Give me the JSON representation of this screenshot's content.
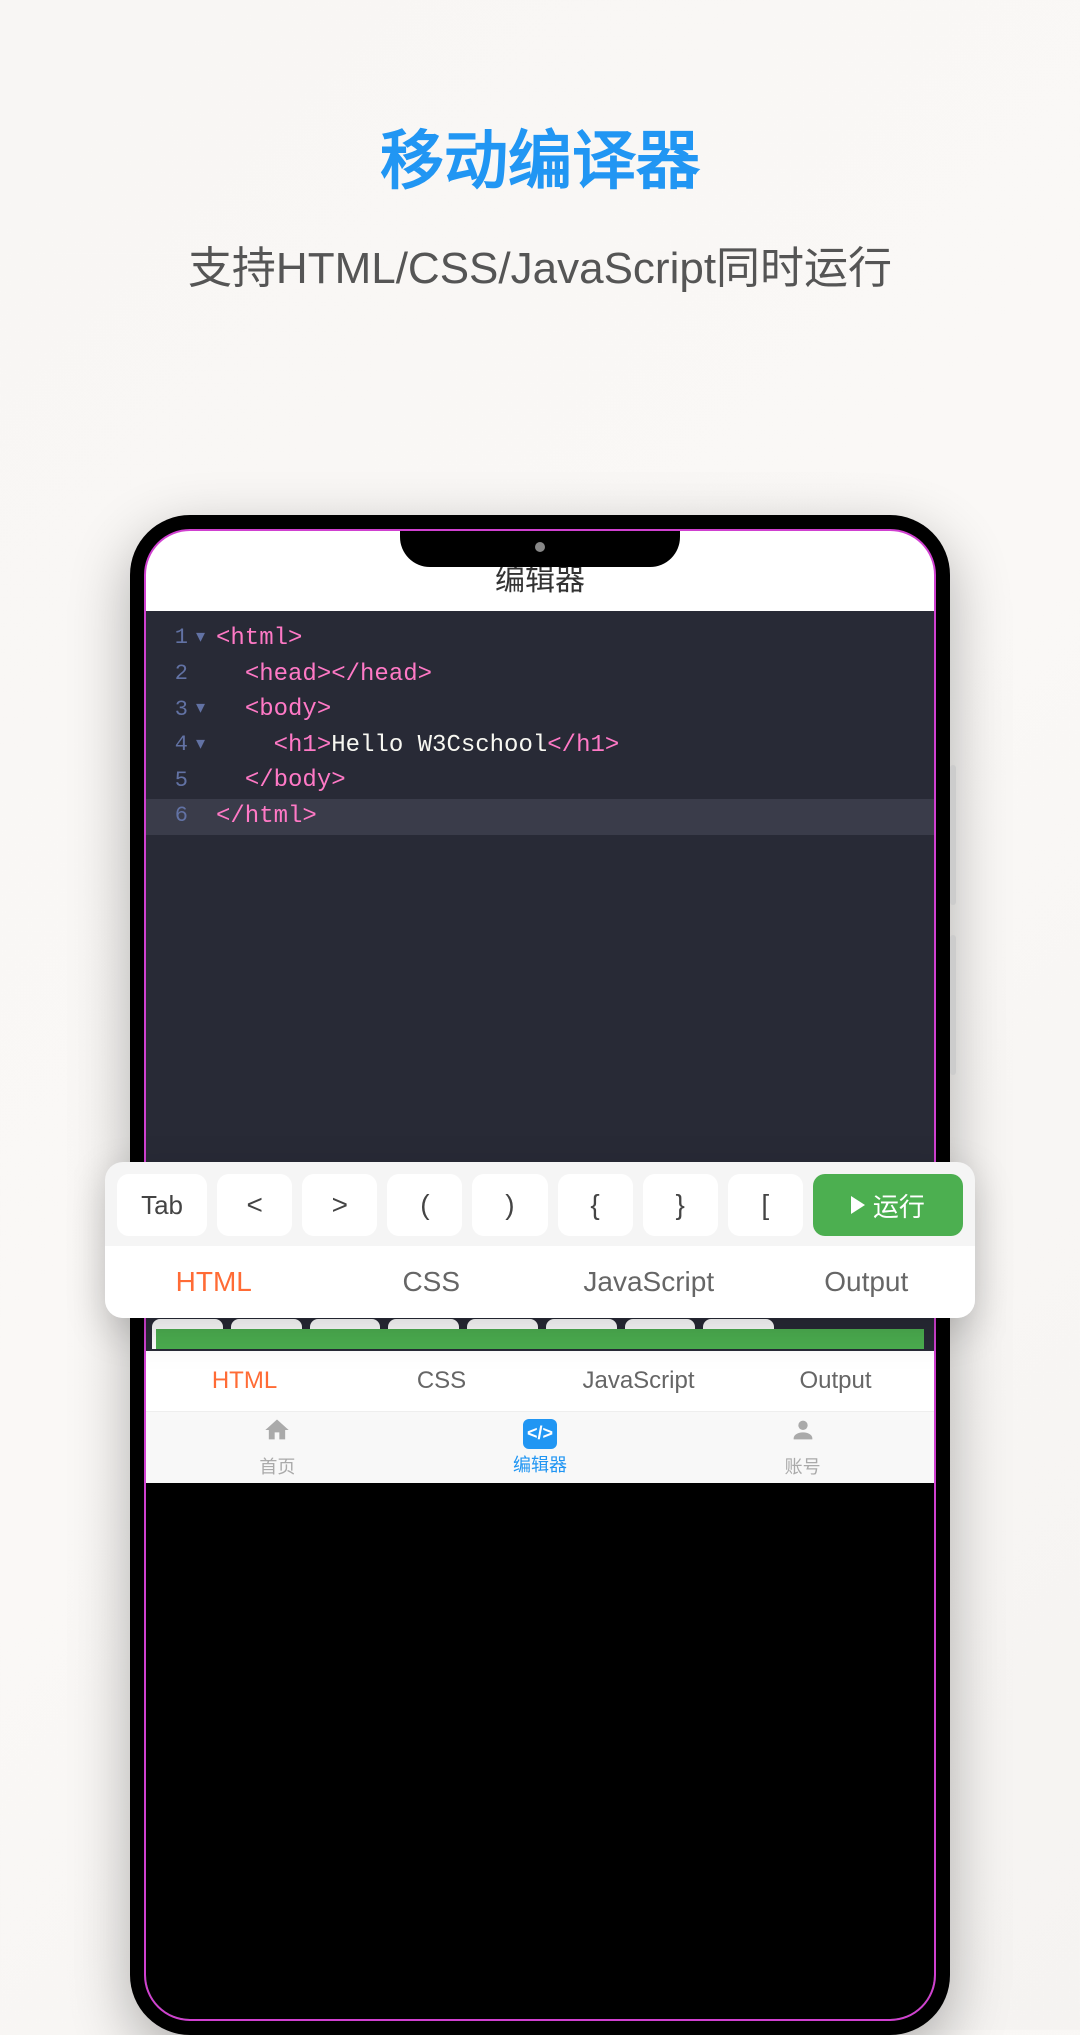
{
  "promo": {
    "title": "移动编译器",
    "subtitle": "支持HTML/CSS/JavaScript同时运行"
  },
  "app": {
    "header_title": "编辑器"
  },
  "code": {
    "lines": [
      {
        "num": "1",
        "fold": "▾",
        "html": "<span class='tok-tag'>&lt;html&gt;</span>"
      },
      {
        "num": "2",
        "fold": "",
        "html": "  <span class='tok-tag'>&lt;head&gt;&lt;/head&gt;</span>"
      },
      {
        "num": "3",
        "fold": "▾",
        "html": "  <span class='tok-tag'>&lt;body&gt;</span>"
      },
      {
        "num": "4",
        "fold": "▾",
        "html": "    <span class='tok-tag'>&lt;h1&gt;</span><span class='tok-text'>Hello W3Cschool</span><span class='tok-tag'>&lt;/h1&gt;</span>"
      },
      {
        "num": "5",
        "fold": "",
        "html": "  <span class='tok-tag'>&lt;/body&gt;</span>"
      },
      {
        "num": "6",
        "fold": "",
        "html": "<span class='tok-tag'>&lt;/html&gt;</span>",
        "hl": true
      }
    ]
  },
  "toolbar": {
    "keys": [
      "Tab",
      "<",
      ">",
      "(",
      ")",
      "{",
      "}",
      "["
    ],
    "run_label": "运行"
  },
  "tabs": {
    "items": [
      "HTML",
      "CSS",
      "JavaScript",
      "Output"
    ],
    "active_index": 0
  },
  "inner_tabs": {
    "items": [
      "HTML",
      "CSS",
      "JavaScript",
      "Output"
    ],
    "active_index": 0
  },
  "bottom_nav": {
    "items": [
      {
        "label": "首页",
        "icon": "home"
      },
      {
        "label": "编辑器",
        "icon": "code"
      },
      {
        "label": "账号",
        "icon": "user"
      }
    ],
    "active_index": 1
  }
}
